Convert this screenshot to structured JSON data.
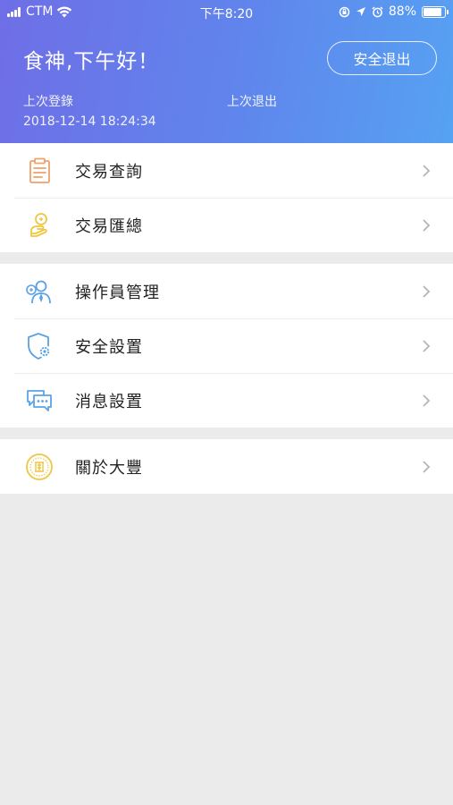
{
  "status_bar": {
    "carrier": "CTM",
    "time": "下午8:20",
    "battery": "88%",
    "battery_level": 0.88
  },
  "header": {
    "greeting": "食神,下午好！",
    "logout_label": "安全退出",
    "last_login_label": "上次登錄",
    "last_login_value": "2018-12-14 18:24:34",
    "last_logout_label": "上次退出",
    "last_logout_value": ""
  },
  "menu": {
    "group1": [
      {
        "label": "交易查詢",
        "icon": "clipboard-icon"
      },
      {
        "label": "交易匯總",
        "icon": "coins-chart-icon"
      }
    ],
    "group2": [
      {
        "label": "操作員管理",
        "icon": "operator-icon"
      },
      {
        "label": "安全設置",
        "icon": "shield-gear-icon"
      },
      {
        "label": "消息設置",
        "icon": "chat-bubbles-icon"
      }
    ],
    "group3": [
      {
        "label": "關於大豐",
        "icon": "bank-seal-icon"
      }
    ]
  },
  "colors": {
    "header_gradient_start": "#6f6ee6",
    "header_gradient_end": "#56a2f3",
    "orange_icon": "#f0a06a",
    "yellow_icon": "#f0c640",
    "blue_icon": "#5aa2e6",
    "background": "#ebebeb"
  }
}
